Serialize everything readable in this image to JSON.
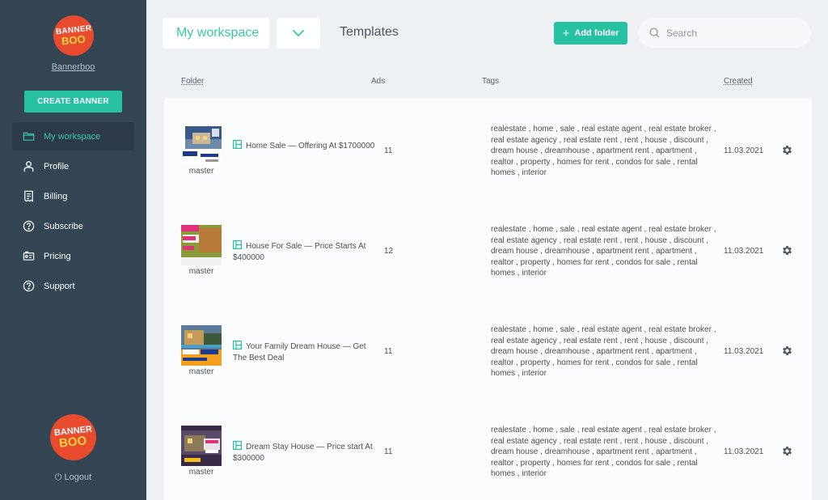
{
  "sidebar": {
    "logo_line1": "BANNER",
    "logo_line2": "BOO",
    "brand_name": "Bannerboo",
    "create_label": "CREATE BANNER",
    "items": [
      {
        "label": "My workspace",
        "icon": "folder-icon"
      },
      {
        "label": "Profile",
        "icon": "user-icon"
      },
      {
        "label": "Billing",
        "icon": "receipt-icon"
      },
      {
        "label": "Subscribe",
        "icon": "question-icon"
      },
      {
        "label": "Pricing",
        "icon": "price-tag-icon"
      },
      {
        "label": "Support",
        "icon": "question-icon"
      }
    ],
    "logout_label": "Logout"
  },
  "topbar": {
    "workspace_label": "My workspace",
    "page_title": "Templates",
    "add_folder_label": "Add folder",
    "search_placeholder": "Search"
  },
  "table": {
    "headers": {
      "folder": "Folder",
      "ads": "Ads",
      "tags": "Tags",
      "created": "Created"
    },
    "rows": [
      {
        "folder": "master",
        "name": "Home Sale — Offering At $1700000",
        "ads": "11",
        "tags": "realestate , home , sale , real estate agent , real estate broker , real estate agency , real estate rent , rent , house , discount , dream house , dreamhouse , apartment rent , apartment , realtor , property , homes for rent , condos for sale , rental homes , interior",
        "created": "11.03.2021"
      },
      {
        "folder": "master",
        "name": "House For Sale — Price Starts At $400000",
        "ads": "12",
        "tags": "realestate , home , sale , real estate agent , real estate broker , real estate agency , real estate rent , rent , house , discount , dream house , dreamhouse , apartment rent , apartment , realtor , property , homes for rent , condos for sale , rental homes , interior",
        "created": "11.03.2021"
      },
      {
        "folder": "master",
        "name": "Your Family Dream House — Get The Best Deal",
        "ads": "11",
        "tags": "realestate , home , sale , real estate agent , real estate broker , real estate agency , real estate rent , rent , house , discount , dream house , dreamhouse , apartment rent , apartment , realtor , property , homes for rent , condos for sale , rental homes , interior",
        "created": "11.03.2021"
      },
      {
        "folder": "master",
        "name": "Dream Stay House — Price start At $300000",
        "ads": "11",
        "tags": "realestate , home , sale , real estate agent , real estate broker , real estate agency , real estate rent , rent , house , discount , dream house , dreamhouse , apartment rent , apartment , realtor , property , homes for rent , condos for sale , rental homes , interior",
        "created": "11.03.2021"
      }
    ]
  },
  "colors": {
    "accent": "#25c1a0",
    "sidebar": "#344553",
    "logo": "#e94b2f"
  }
}
